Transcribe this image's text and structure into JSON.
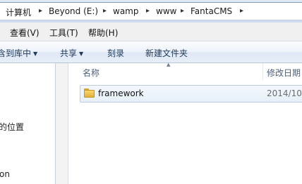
{
  "address_bar": {
    "crumbs": [
      "计算机",
      "Beyond (E:)",
      "wamp",
      "www",
      "FantaCMS"
    ],
    "separator": "▸"
  },
  "menu_bar": {
    "items": [
      "查看(V)",
      "工具(T)",
      "帮助(H)"
    ]
  },
  "command_bar": {
    "items": [
      {
        "label": "含到库中",
        "dropdown": true
      },
      {
        "label": "共享",
        "dropdown": true
      },
      {
        "label": "刻录",
        "dropdown": false
      },
      {
        "label": "新建文件夹",
        "dropdown": false
      }
    ]
  },
  "nav_pane": {
    "items": [
      "的位置",
      "on"
    ]
  },
  "file_list": {
    "columns": [
      "名称",
      "修改日期"
    ],
    "sorted_column": "名称",
    "rows": [
      {
        "name": "framework",
        "modified": "2014/10/",
        "icon": "folder-icon",
        "selected": true
      }
    ]
  }
}
